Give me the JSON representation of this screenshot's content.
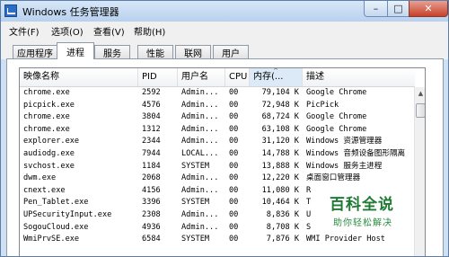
{
  "window": {
    "title": "Windows 任务管理器"
  },
  "controls": {
    "minimize": "–",
    "maximize": "□",
    "close": "✕"
  },
  "menu": [
    {
      "label": "文件(F)"
    },
    {
      "label": "选项(O)"
    },
    {
      "label": "查看(V)"
    },
    {
      "label": "帮助(H)"
    }
  ],
  "tabs": [
    {
      "label": "应用程序",
      "active": false
    },
    {
      "label": "进程",
      "active": true
    },
    {
      "label": "服务",
      "active": false
    },
    {
      "label": "性能",
      "active": false
    },
    {
      "label": "联网",
      "active": false
    },
    {
      "label": "用户",
      "active": false
    }
  ],
  "columns": [
    {
      "label": "映像名称"
    },
    {
      "label": "PID"
    },
    {
      "label": "用户名"
    },
    {
      "label": "CPU"
    },
    {
      "label": "内存(..."
    },
    {
      "label": "描述"
    }
  ],
  "sorted_column_caret": "^",
  "scroll_up_glyph": "▲",
  "rows": [
    [
      "chrome.exe",
      "2592",
      "Admin...",
      "00",
      "79,104 K",
      "Google Chrome"
    ],
    [
      "picpick.exe",
      "4576",
      "Admin...",
      "00",
      "72,948 K",
      "PicPick"
    ],
    [
      "chrome.exe",
      "3804",
      "Admin...",
      "00",
      "68,724 K",
      "Google Chrome"
    ],
    [
      "chrome.exe",
      "1312",
      "Admin...",
      "00",
      "63,108 K",
      "Google Chrome"
    ],
    [
      "explorer.exe",
      "2344",
      "Admin...",
      "00",
      "31,120 K",
      "Windows 资源管理器"
    ],
    [
      "audiodg.exe",
      "7944",
      "LOCAL...",
      "00",
      "14,788 K",
      "Windows 音频设备图形隔离"
    ],
    [
      "svchost.exe",
      "1184",
      "SYSTEM",
      "00",
      "13,888 K",
      "Windows 服务主进程"
    ],
    [
      "dwm.exe",
      "2068",
      "Admin...",
      "00",
      "12,220 K",
      "桌面窗口管理器"
    ],
    [
      "cnext.exe",
      "4156",
      "Admin...",
      "00",
      "11,080 K",
      "R"
    ],
    [
      "Pen_Tablet.exe",
      "3396",
      "SYSTEM",
      "00",
      "10,464 K",
      "T"
    ],
    [
      "UPSecurityInput.exe",
      "2308",
      "Admin...",
      "00",
      "8,836 K",
      "U"
    ],
    [
      "SogouCloud.exe",
      "4936",
      "Admin...",
      "00",
      "8,708 K",
      "S"
    ],
    [
      "WmiPrvSE.exe",
      "6584",
      "SYSTEM",
      "00",
      "7,876 K",
      "WMI Provider Host"
    ]
  ],
  "watermark": {
    "line1": "百科全说",
    "line2": "助你轻松解决"
  }
}
